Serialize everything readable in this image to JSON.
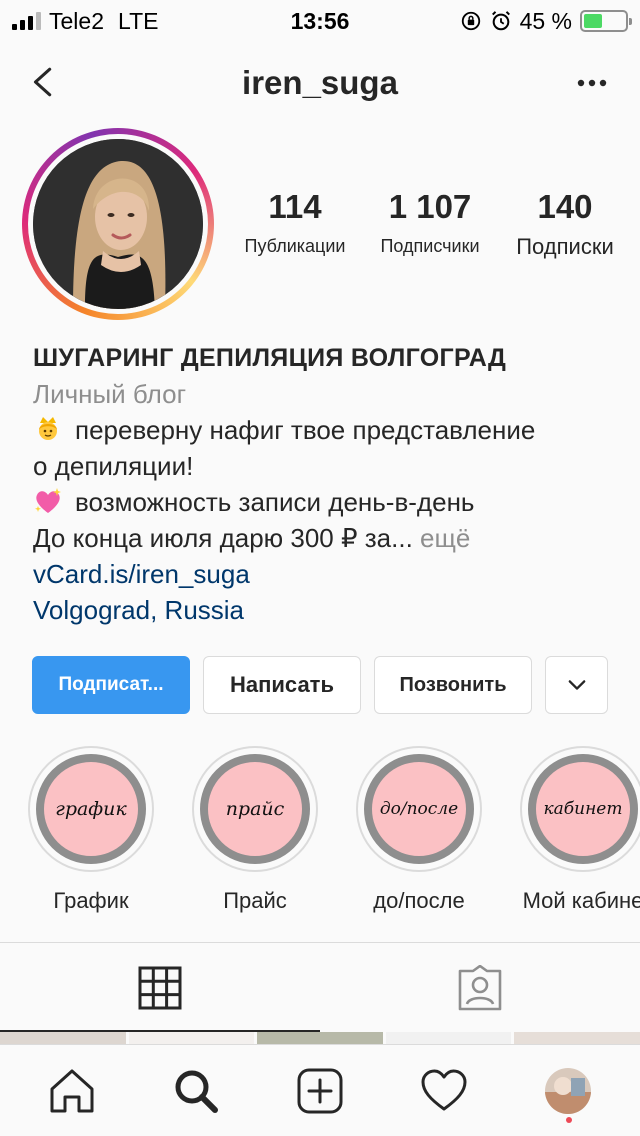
{
  "status_bar": {
    "carrier": "Tele2",
    "network": "LTE",
    "time": "13:56",
    "battery_percent": "45 %",
    "battery_level": 0.45
  },
  "header": {
    "username": "iren_suga"
  },
  "profile": {
    "stats": [
      {
        "value": "114",
        "label": "Публикации"
      },
      {
        "value": "1 107",
        "label": "Подписчики"
      },
      {
        "value": "140",
        "label": "Подписки"
      }
    ],
    "name": "ШУГАРИНГ ДЕПИЛЯЦИЯ ВОЛГОГРАД",
    "category": "Личный блог",
    "bio_line1": "переверну нафиг твое представление",
    "bio_line2": "о депиляции!",
    "bio_line3": "возможность записи день-в-день",
    "bio_line4": "До конца июля дарю 300 ₽ за...",
    "more": "ещё",
    "website": "vCard.is/iren_suga",
    "location": "Volgograd, Russia"
  },
  "actions": {
    "follow": "Подписат...",
    "message": "Написать",
    "call": "Позвонить"
  },
  "highlights": [
    {
      "cover_text": "график",
      "label": "График"
    },
    {
      "cover_text": "прайс",
      "label": "Прайс"
    },
    {
      "cover_text": "до/после",
      "label": "до/после"
    },
    {
      "cover_text": "кабинет",
      "label": "Мой кабине"
    }
  ],
  "colors": {
    "accent": "#3897f0",
    "link": "#00376b",
    "highlight_fill": "#fbc1c4",
    "notification": "#ed4956"
  },
  "icons": {
    "back": "chevron-left-icon",
    "more": "more-horizontal-icon",
    "grid_tab": "grid-icon",
    "tagged_tab": "tagged-icon",
    "nav": [
      "home-icon",
      "search-icon",
      "add-post-icon",
      "heart-icon",
      "profile-avatar"
    ]
  }
}
